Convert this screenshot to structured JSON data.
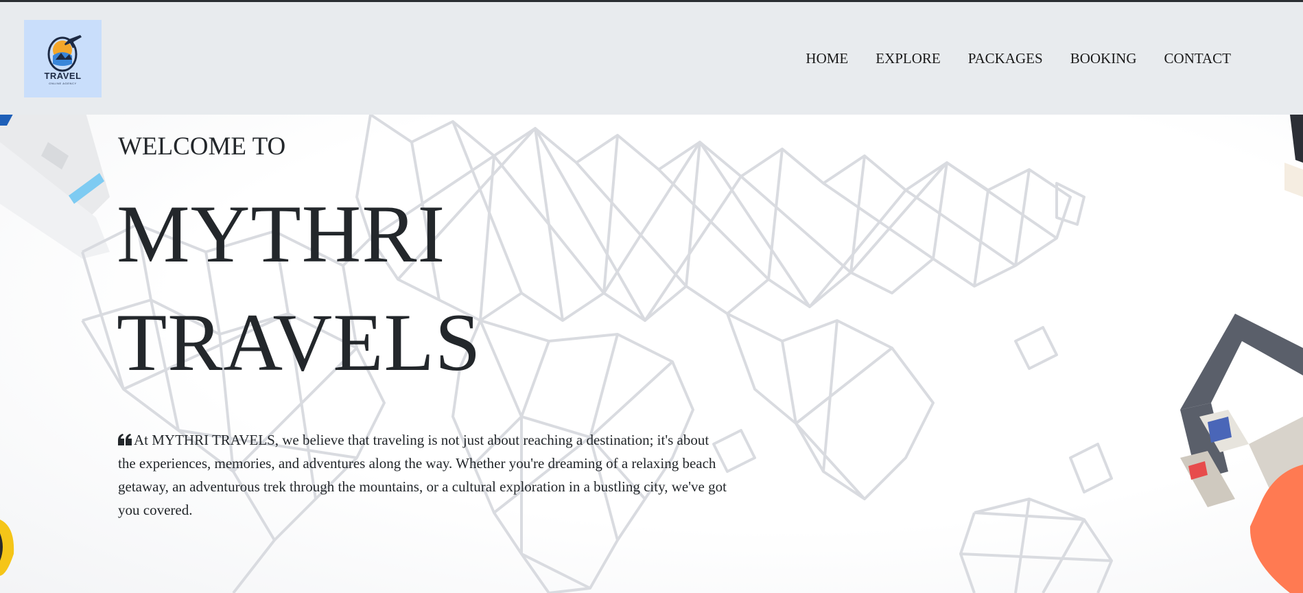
{
  "logo": {
    "title": "TRAVEL",
    "subtitle": "ONLINE AGENCY",
    "icon": "airplane-globe-logo"
  },
  "nav": {
    "items": [
      {
        "label": "HOME"
      },
      {
        "label": "EXPLORE"
      },
      {
        "label": "PACKAGES"
      },
      {
        "label": "BOOKING"
      },
      {
        "label": "CONTACT"
      }
    ]
  },
  "hero": {
    "welcome": "WELCOME TO",
    "title_line1": "MYTHRI",
    "title_line2": "TRAVELS",
    "quote_icon": "quote-left-icon",
    "tagline": "At MYTHRI TRAVELS, we believe that traveling is not just about reaching a destination; it's about the experiences, memories, and adventures along the way. Whether you're dreaming of a relaxing beach getaway, an adventurous trek through the mountains, or a cultural exploration in a bustling city, we've got you covered."
  },
  "colors": {
    "navbar_bg": "#e8ebee",
    "logo_bg": "#c9defb",
    "text": "#23272b",
    "map_lines": "#d9dbe0",
    "suitcase_orange": "#ff7a52"
  }
}
